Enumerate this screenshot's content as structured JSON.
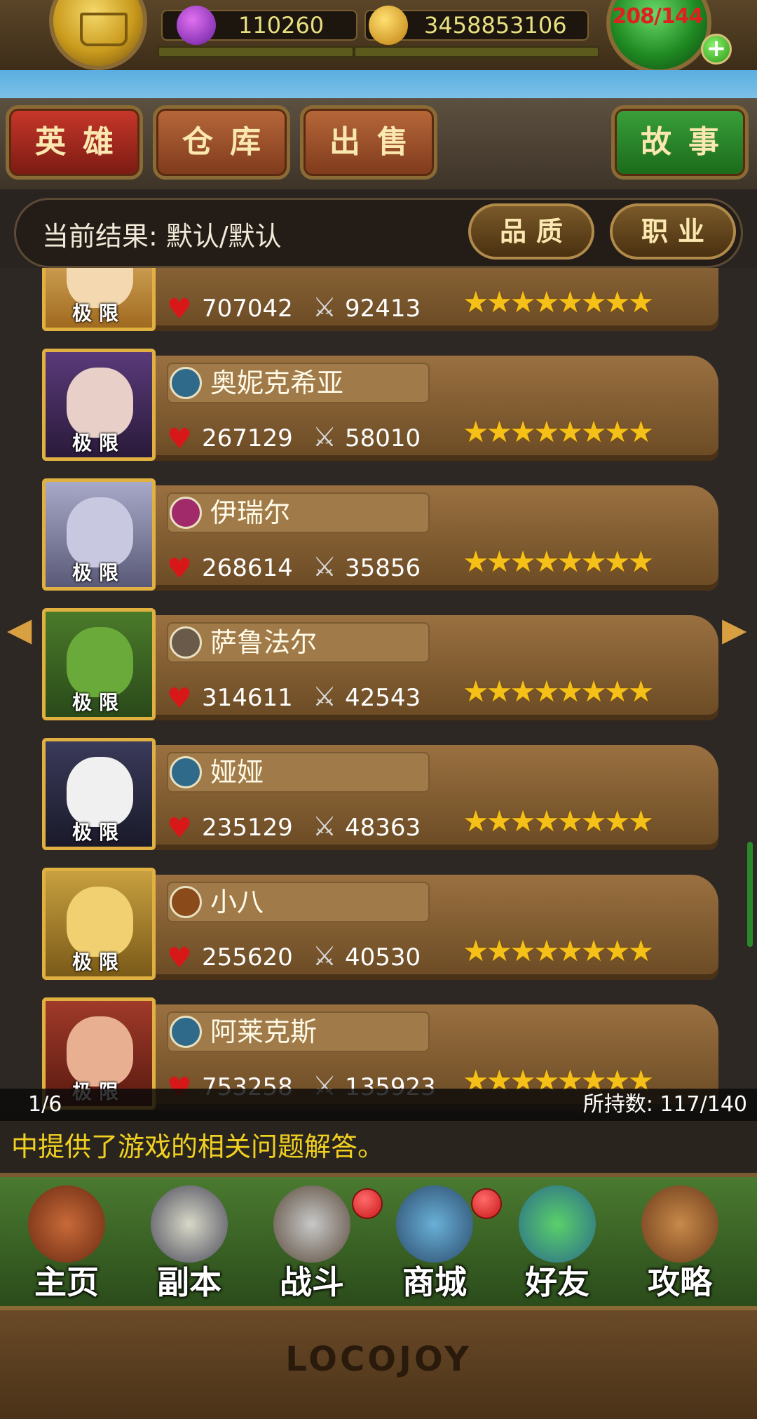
{
  "resources": {
    "gems": "110260",
    "gold": "3458853106",
    "stamina": "208/144"
  },
  "tabs": [
    {
      "label": "英雄"
    },
    {
      "label": "仓库"
    },
    {
      "label": "出售"
    },
    {
      "label": "故事"
    }
  ],
  "filter": {
    "label": "当前结果: 默认/默认",
    "quality_button": "品质",
    "class_button": "职业"
  },
  "heroes": [
    {
      "name": "",
      "rank": "极限",
      "hp": "707042",
      "atk": "92413",
      "stars": 8
    },
    {
      "name": "奥妮克希亚",
      "rank": "极限",
      "hp": "267129",
      "atk": "58010",
      "stars": 8
    },
    {
      "name": "伊瑞尔",
      "rank": "极限",
      "hp": "268614",
      "atk": "35856",
      "stars": 8
    },
    {
      "name": "萨鲁法尔",
      "rank": "极限",
      "hp": "314611",
      "atk": "42543",
      "stars": 8
    },
    {
      "name": "娅娅",
      "rank": "极限",
      "hp": "235129",
      "atk": "48363",
      "stars": 8
    },
    {
      "name": "小八",
      "rank": "极限",
      "hp": "255620",
      "atk": "40530",
      "stars": 8
    },
    {
      "name": "阿莱克斯",
      "rank": "极限",
      "hp": "753258",
      "atk": "135923",
      "stars": 8
    }
  ],
  "page": {
    "current": "1/6",
    "owned": "所持数: 117/140"
  },
  "ticker": "中提供了游戏的相关问题解答。",
  "nav": [
    {
      "label": "主页"
    },
    {
      "label": "副本"
    },
    {
      "label": "战斗"
    },
    {
      "label": "商城"
    },
    {
      "label": "好友"
    },
    {
      "label": "攻略"
    }
  ],
  "logo": "LOCOJOY",
  "colors": {
    "accent_gold": "#e0b040",
    "star": "#f5c018",
    "hp_red": "#d81818",
    "ticker_yellow": "#f0d020",
    "stamina_text": "#e02020"
  }
}
